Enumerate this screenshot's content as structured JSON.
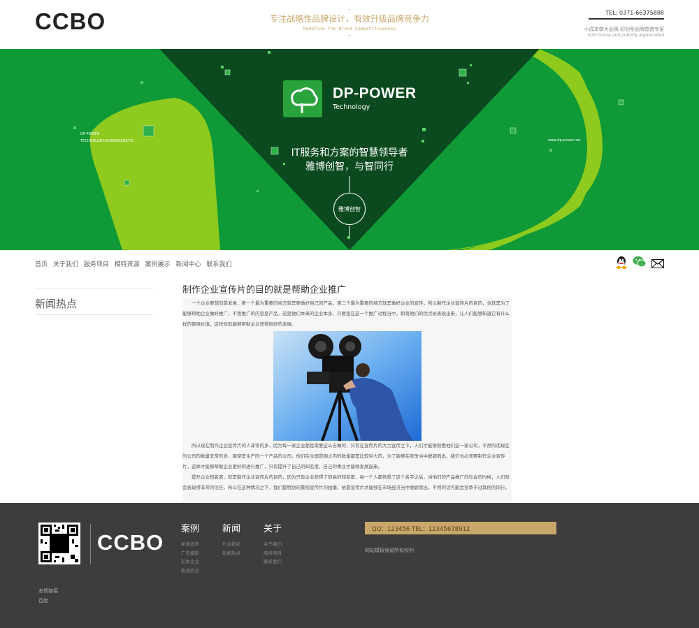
{
  "header": {
    "logo": "CCBO",
    "slogan_cn": "专注战略性品牌设计，有效升级品牌竞争力",
    "slogan_en": "Redefine The Brand Competitiveness",
    "tel": "TEL: 0371-66375888",
    "tag_cn": "小成本做大品牌,初创型品牌塑造专家",
    "tag_en": "SGO Group and publicly appreciated"
  },
  "banner": {
    "brand": "DP-POWER",
    "brand_sub": "Technology",
    "tagline1": "IT服务和方案的智慧领导者",
    "tagline2": "雅博创智，与智同行",
    "circle_label": "雅博创智",
    "left_small_1": "DP-POWER",
    "left_small_2": "TECHNOLOGY(SHENZHEN)LTD.",
    "right_small": "www.dp-power.net",
    "colors": {
      "dark": "#0b4a1f",
      "green": "#0f9a37",
      "lime": "#8ecb1e"
    }
  },
  "nav": {
    "items": [
      "首页",
      "关于我们",
      "服务项目",
      "模特资源",
      "案例展示",
      "新闻中心",
      "联系我们"
    ],
    "icons": [
      "qq-icon",
      "wechat-icon",
      "mail-icon"
    ]
  },
  "sidebar": {
    "title": "新闻热点"
  },
  "article": {
    "title": "制作企业宣传片的目的就是帮助企业推广",
    "p1": "一个企业要想向前发展，第一个最为重要的地方就是要做好自己的产品，第二个最为重要的地方就是做好企业的宣传，所以制作企业宣传片的目的，也就是为了能够帮助企业做好推广，不管推广的内容是产品，还是他们本来的企业本身，只要是在这一个推广过程当中，和将他们的优点给表现出来，让人们能够知道它有什么样的使用价值，这样也就能够帮助企业获得很好的发展。",
    "p2": "所以现在制作企业宣传片的人非常的多，因为每一家企业都是需要这么去做的，只有在宣传片的大力宣传之下，人们才能够熟悉他们这一家公司，不然的话现在的公司的数量非常的多，那使是生产同一个产品的公司，他们在全国范围之内的数量都是比较巨大的，为了能够在竞争当中脱颖而出，我们也必须要制作企业宣传片，这样才能够帮助企业更好的进行推广，只有提升了自己的知名度，自己的事业才能够发展起来。",
    "p3": "提升企业知名度，就是制作企业宣传片的目的，因为只有企业获得了很高的知名度，每一个人都熟悉了这个名字之后，当他们的产品推广向社会的时候，人们就会表现得非常的信任，所以在这种情况之下，我们都特别的重视宣传片的拍摄，依靠宣传片才能够在市场经济当中脱颖而出，不然的话可能会竞争不过其他的同行。"
  },
  "footer": {
    "logo": "CCBO",
    "col1": {
      "title": "案例",
      "items": [
        "新闻发布",
        "广告摄影",
        "形象企业",
        "影视商业"
      ]
    },
    "col2": {
      "title": "新闻",
      "items": [
        "行业新闻",
        "新闻热点"
      ]
    },
    "col3": {
      "title": "关于",
      "items": [
        "关于我们",
        "服务项目",
        "联系我们"
      ]
    },
    "contact": "QQ：123456   TEL：12345678912",
    "copyright": "网站模板保留所有权利",
    "links_title": "友情链接",
    "links": [
      "百度"
    ]
  }
}
